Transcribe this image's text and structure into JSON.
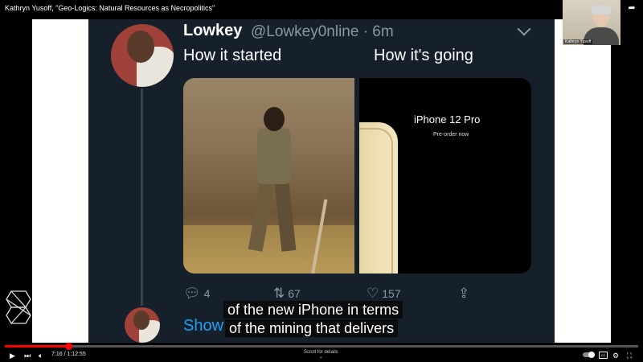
{
  "window": {
    "title": "Kathryn Yusoff, \"Geo-Logics: Natural Resources as Necropolitics\""
  },
  "top_icons": [
    "clock-icon",
    "share-icon"
  ],
  "webcam": {
    "label": "Kathryn Yusoff"
  },
  "tweet": {
    "name": "Lowkey",
    "handle": "@Lowkey0nline · 6m",
    "caption_left": "How it started",
    "caption_right": "How it's going",
    "product_brand": "iPhone 12 Pro",
    "product_sub": "Pre-order now",
    "actions": {
      "replies": "4",
      "retweets": "67",
      "likes": "157"
    },
    "show_text": "Show"
  },
  "subtitles": {
    "line1": "of the new iPhone in terms",
    "line2": "of the mining that delivers"
  },
  "player": {
    "time": "7:16 / 1:12:55",
    "progress_fraction": 0.0998,
    "scroll_label": "Scroll for details"
  },
  "colors": {
    "accent": "#ff0000",
    "link": "#1da1f2",
    "tweet_bg": "#15202b"
  }
}
